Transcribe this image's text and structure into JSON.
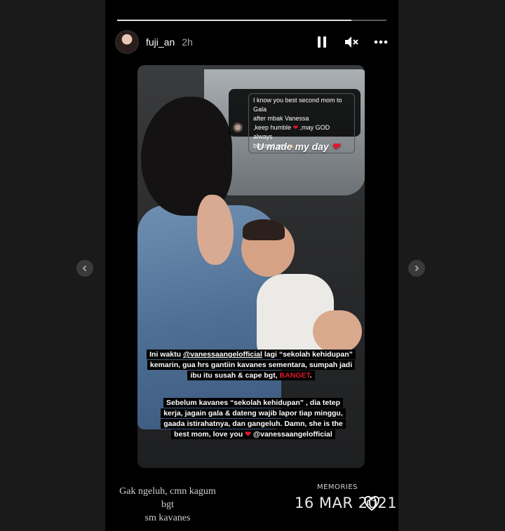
{
  "header": {
    "username": "fuji_an",
    "time": "2h"
  },
  "progress": {
    "segments": 1,
    "completed": 0.87
  },
  "dm": {
    "lines": [
      "I know you best second mom to Gala",
      "after mbak Vanessa",
      ",keep humble",
      ",may GOD always",
      "blessed you"
    ]
  },
  "sticker": {
    "text": "U made my day"
  },
  "caption1": {
    "prefix": "Ini waktu ",
    "mention": "@vanessaangelofficial",
    "body": " lagi “sekolah kehidupan”  kemarin, gua hrs gantiin kavanes sementara, sumpah jadi ibu itu susah & cape bgt, ",
    "emphasis": "BANGET",
    "suffix": "."
  },
  "caption2": {
    "body": "Sebelum kavanes “sekolah kehidupan” , dia tetep kerja, jagain gala & dateng wajib lapor tiap minggu, gaada istirahatnya, dan gangeluh. Damn, she is the best mom, love you",
    "mention": "@vanessaangelofficial"
  },
  "footer": {
    "note_line1": "Gak ngeluh, cmn kagum bgt",
    "note_line2": "sm kavanes",
    "memories_label": "MEMORIES",
    "date": "16 MAR 2021"
  },
  "colors": {
    "heart": "#e0182a",
    "background": "#1a1a1a",
    "story_bg": "#000000"
  },
  "icons": [
    "pause-icon",
    "mute-icon",
    "more-icon",
    "chevron-left-icon",
    "chevron-right-icon",
    "heart-icon",
    "pray-icon",
    "double-heart-icon"
  ]
}
